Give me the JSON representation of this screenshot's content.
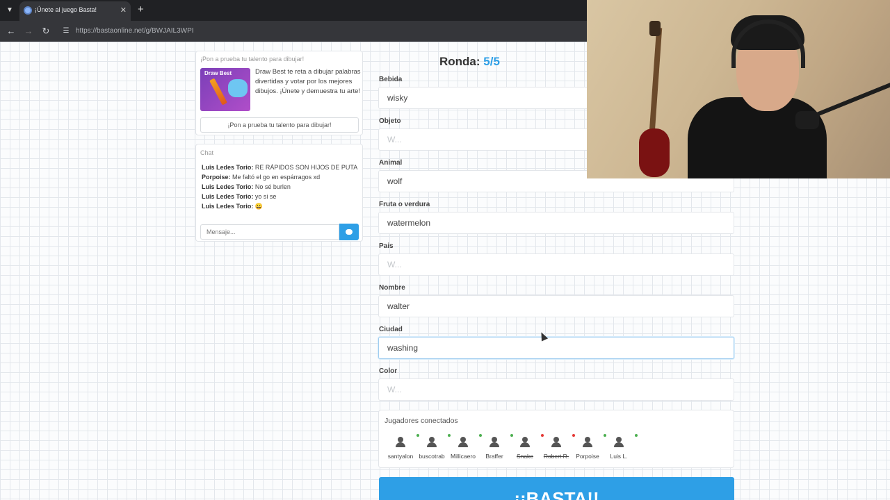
{
  "browser": {
    "tab_title": "¡Únete al juego Basta!",
    "url": "https://bastaonline.net/g/BWJAIL3WPI"
  },
  "promo": {
    "header": "¡Pon a prueba tu talento para dibujar!",
    "image_title": "Draw Best",
    "text": "Draw Best te reta a dibujar palabras divertidas y votar por los mejores dibujos. ¡Únete y demuestra tu arte!",
    "button": "¡Pon a prueba tu talento para dibujar!"
  },
  "chat": {
    "header": "Chat",
    "messages": [
      {
        "user": "Luis Ledes Torio:",
        "text": "RE RÁPIDOS SON HIJOS DE PUTA"
      },
      {
        "user": "Porpoise:",
        "text": "Me faltó el go en espárragos xd"
      },
      {
        "user": "Luis Ledes Torio:",
        "text": "No sé burlen"
      },
      {
        "user": "Luis Ledes Torio:",
        "text": "yo si se"
      },
      {
        "user": "Luis Ledes Torio:",
        "text": "😀"
      }
    ],
    "placeholder": "Mensaje..."
  },
  "round": {
    "label": "Ronda:",
    "value": "5/5"
  },
  "fields": [
    {
      "label": "Bebida",
      "value": "wisky",
      "placeholder": "W..."
    },
    {
      "label": "Objeto",
      "value": "",
      "placeholder": "W..."
    },
    {
      "label": "Animal",
      "value": "wolf",
      "placeholder": "W..."
    },
    {
      "label": "Fruta o verdura",
      "value": "watermelon",
      "placeholder": "W..."
    },
    {
      "label": "Pais",
      "value": "",
      "placeholder": "W..."
    },
    {
      "label": "Nombre",
      "value": "walter",
      "placeholder": "W..."
    },
    {
      "label": "Ciudad",
      "value": "washing",
      "placeholder": "W..."
    },
    {
      "label": "Color",
      "value": "",
      "placeholder": "W..."
    }
  ],
  "players": {
    "header": "Jugadores conectados",
    "list": [
      {
        "name": "santyalon",
        "status_color": "#4caf50",
        "out": false
      },
      {
        "name": "buscotrab",
        "status_color": "#4caf50",
        "out": false
      },
      {
        "name": "Millicaero",
        "status_color": "#4caf50",
        "out": false
      },
      {
        "name": "Braffer",
        "status_color": "#4caf50",
        "out": false
      },
      {
        "name": "Snake",
        "status_color": "#e53935",
        "out": true
      },
      {
        "name": "Robert R.",
        "status_color": "#e53935",
        "out": true
      },
      {
        "name": "Porpoise",
        "status_color": "#4caf50",
        "out": false
      },
      {
        "name": "Luis L.",
        "status_color": "#4caf50",
        "out": false
      }
    ]
  },
  "basta_button": "¡¡BASTA!!",
  "colors": {
    "accent": "#2e9fe6"
  }
}
